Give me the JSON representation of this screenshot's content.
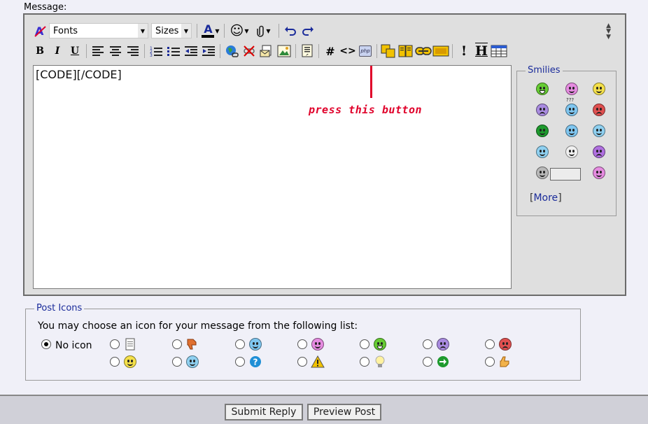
{
  "message_label": "Message:",
  "toolbar": {
    "font_select": "Fonts",
    "size_select": "Sizes",
    "font_color_letter": "A",
    "bold": "B",
    "italic": "I",
    "underline": "U",
    "code_button_glyph": "#",
    "html_button_glyph": "<>",
    "php_button_label": "php",
    "exclaim": "!",
    "header_glyph": "H"
  },
  "editor": {
    "content": "[CODE][/CODE]"
  },
  "annotation": {
    "text": "press this button",
    "color": "#e0002a"
  },
  "smilies": {
    "legend": "Smilies",
    "more_label": "More",
    "grid": [
      {
        "icon": "grin-smiley-icon",
        "color": "#66cc33"
      },
      {
        "icon": "pink-smiley-icon",
        "color": "#e58be0"
      },
      {
        "icon": "smile-smiley-icon",
        "color": "#f4e04a"
      },
      {
        "icon": "frown-smiley-icon",
        "color": "#a98be0"
      },
      {
        "icon": "confused-smiley-icon",
        "color": "#7fc6f0",
        "badge": "???"
      },
      {
        "icon": "mad-smiley-icon",
        "color": "#e05050"
      },
      {
        "icon": "green-smiley-icon",
        "color": "#1e9a2e"
      },
      {
        "icon": "wink-smiley-icon",
        "color": "#7fc6f0"
      },
      {
        "icon": "eek-smiley-icon",
        "color": "#8fd0f0"
      },
      {
        "icon": "cool-smiley-icon",
        "color": "#8fd0f0"
      },
      {
        "icon": "shocked-smiley-icon",
        "color": "#f0f0f0"
      },
      {
        "icon": "purple-smiley-icon",
        "color": "#b070e0"
      },
      {
        "icon": "grey-smiley-icon",
        "color": "#b8b8b8"
      },
      {
        "icon": "blank-smiley-icon",
        "color": "#ececec"
      },
      {
        "icon": "tongue-smiley-icon",
        "color": "#e58be0"
      }
    ]
  },
  "post_icons": {
    "legend": "Post Icons",
    "prompt": "You may choose an icon for your message from the following list:",
    "no_icon_label": "No icon",
    "row1": [
      {
        "icon": "document-icon"
      },
      {
        "icon": "thumbs-down-icon"
      },
      {
        "icon": "wink-icon",
        "color": "#7fc6f0"
      },
      {
        "icon": "pink-smiley-icon",
        "color": "#e58be0"
      },
      {
        "icon": "grin-icon",
        "color": "#66cc33"
      },
      {
        "icon": "frown-icon",
        "color": "#a98be0"
      },
      {
        "icon": "mad-icon",
        "color": "#e05050"
      }
    ],
    "row2": [
      {
        "icon": "smile-icon",
        "color": "#f4e04a"
      },
      {
        "icon": "cool-icon",
        "color": "#8fd0f0"
      },
      {
        "icon": "question-icon",
        "color": "#1f8fd6"
      },
      {
        "icon": "warning-icon",
        "color": "#f2c200"
      },
      {
        "icon": "lightbulb-icon",
        "color": "#fff2a0"
      },
      {
        "icon": "arrow-icon",
        "color": "#1e9a2e"
      },
      {
        "icon": "thumbs-up-icon",
        "color": "#f2b24a"
      }
    ]
  },
  "buttons": {
    "submit": "Submit Reply",
    "preview": "Preview Post"
  }
}
